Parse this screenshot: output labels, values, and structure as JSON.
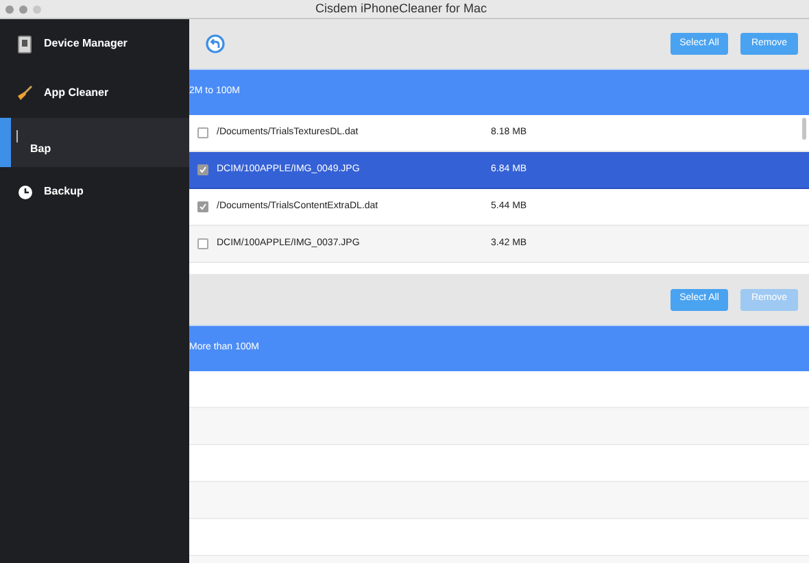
{
  "window": {
    "title": "Cisdem iPhoneCleaner for Mac"
  },
  "sidebar": {
    "items": [
      {
        "label": "Device Manager",
        "kind": "device",
        "selected": false
      },
      {
        "label": "App Cleaner",
        "kind": "broom",
        "selected": false
      },
      {
        "label": "Bap",
        "kind": "none",
        "selected": true
      },
      {
        "label": "Backup",
        "kind": "clock",
        "selected": false
      }
    ]
  },
  "sections": [
    {
      "buttons": [
        {
          "label": "Select All",
          "disabled": false
        },
        {
          "label": "Remove",
          "disabled": false
        }
      ],
      "header": "2M to 100M",
      "rows": [
        {
          "path": "/Documents/TrialsTexturesDL.dat",
          "size": "8.18 MB",
          "checked": false,
          "selected": false
        },
        {
          "path": "DCIM/100APPLE/IMG_0049.JPG",
          "size": "6.84 MB",
          "checked": true,
          "selected": true
        },
        {
          "path": "/Documents/TrialsContentExtraDL.dat",
          "size": "5.44 MB",
          "checked": true,
          "selected": false
        },
        {
          "path": "DCIM/100APPLE/IMG_0037.JPG",
          "size": "3.42 MB",
          "checked": false,
          "selected": false
        }
      ]
    },
    {
      "buttons": [
        {
          "label": "Select All",
          "disabled": false
        },
        {
          "label": "Remove",
          "disabled": true
        }
      ],
      "header": "More than 100M"
    }
  ]
}
